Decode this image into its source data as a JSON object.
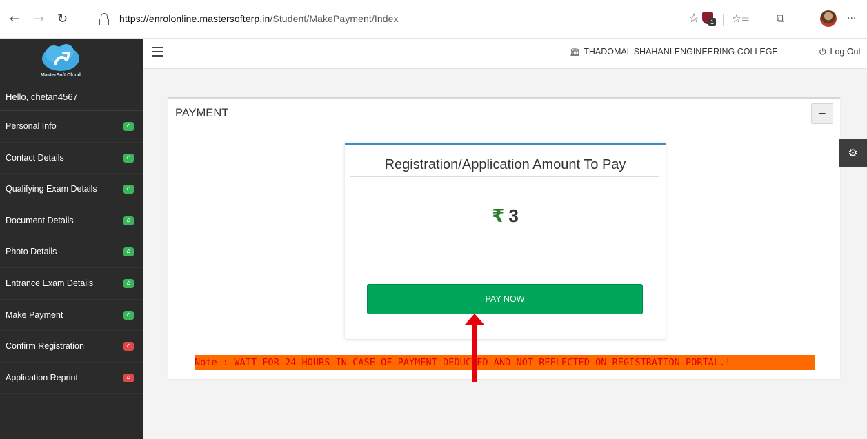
{
  "browser": {
    "back_icon": "←",
    "forward_icon": "→",
    "refresh_icon": "↻",
    "url_host": "https://enrolonline.mastersofterp.in",
    "url_path": "/Student/MakePayment/Index",
    "favorite_icon": "☆",
    "favorites_list_icon": "☆≡",
    "collections_icon": "⧉",
    "more_icon": "···",
    "extension_badge": "1"
  },
  "sidebar": {
    "logo_caption": "MasterSoft Cloud",
    "greeting": "Hello, chetan4567",
    "items": [
      {
        "label": "Personal Info",
        "status": "green"
      },
      {
        "label": "Contact Details",
        "status": "green"
      },
      {
        "label": "Qualifying Exam Details",
        "status": "green"
      },
      {
        "label": "Document Details",
        "status": "green"
      },
      {
        "label": "Photo Details",
        "status": "green"
      },
      {
        "label": "Entrance Exam Details",
        "status": "green"
      },
      {
        "label": "Make Payment",
        "status": "green"
      },
      {
        "label": "Confirm Registration",
        "status": "red"
      },
      {
        "label": "Application Reprint",
        "status": "red"
      }
    ],
    "status_icon": "⌂"
  },
  "topbar": {
    "college_icon": "🏛",
    "college_name": "THADOMAL SHAHANI ENGINEERING COLLEGE",
    "logout_icon": "⏻",
    "logout_label": "Log Out"
  },
  "panel": {
    "title": "PAYMENT",
    "collapse_label": "−"
  },
  "payment": {
    "heading": "Registration/Application Amount To Pay",
    "currency_symbol": "₹",
    "amount": "3",
    "pay_button_label": "PAY NOW"
  },
  "note": "Note : WAIT FOR 24 HOURS IN CASE OF PAYMENT DEDUCTED AND NOT REFLECTED ON REGISTRATION PORTAL.!",
  "settings_icon": "⚙",
  "colors": {
    "sidebar_bg": "#2b2b2b",
    "pay_button": "#00a65a",
    "status_green": "#3cb55a",
    "status_red": "#e04848",
    "note_bg": "#ff6a00",
    "note_text": "#e00000",
    "box_accent": "#3c8dbc",
    "annotation_arrow": "#e8000b"
  }
}
